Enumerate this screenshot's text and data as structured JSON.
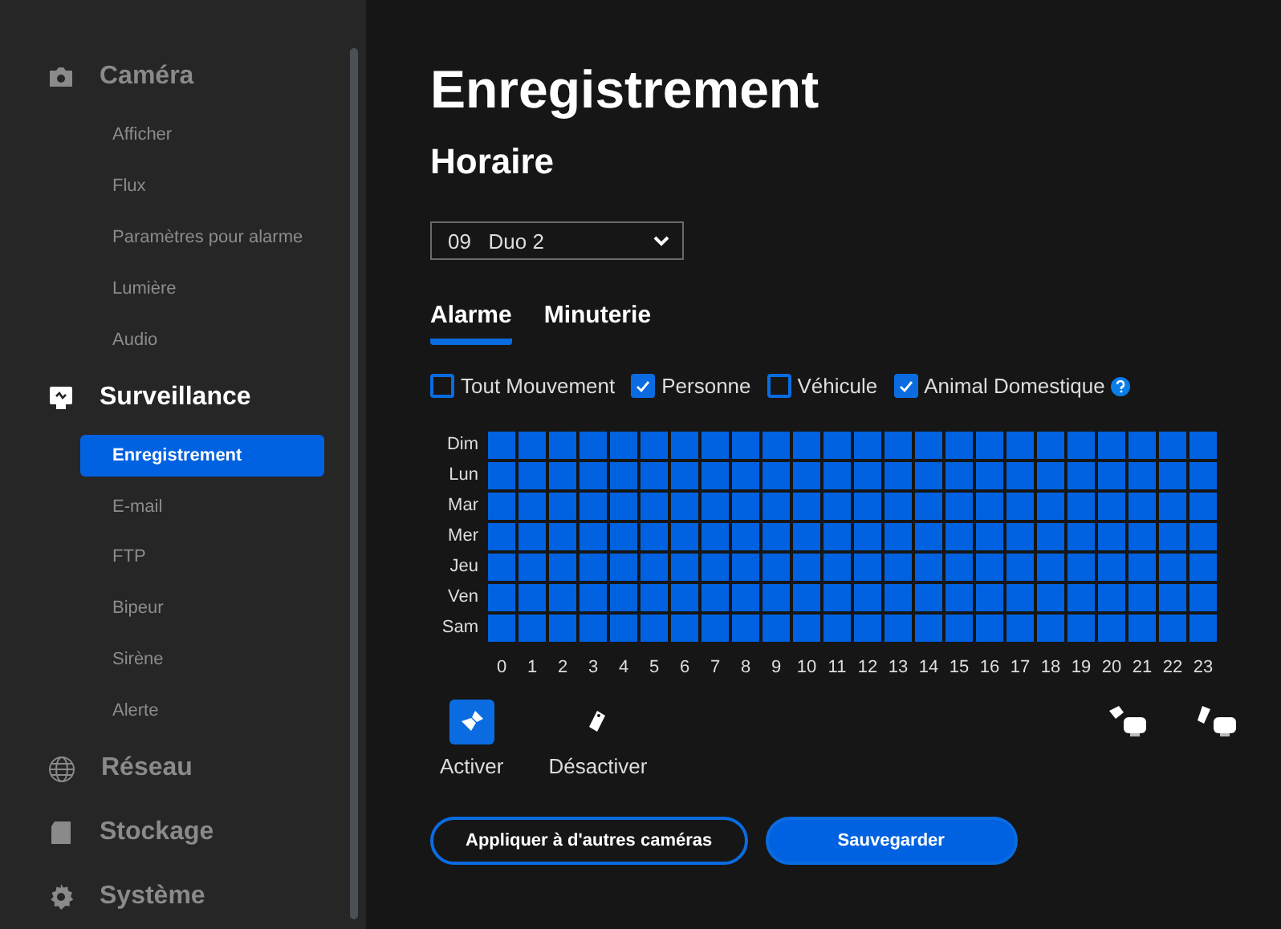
{
  "sidebar": {
    "groups": [
      {
        "kind": "camera",
        "label": "Caméra",
        "selected": false,
        "items": [
          {
            "label": "Afficher",
            "selected": false
          },
          {
            "label": "Flux",
            "selected": false
          },
          {
            "label": "Paramètres pour alarme",
            "selected": false
          },
          {
            "label": "Lumière",
            "selected": false
          },
          {
            "label": "Audio",
            "selected": false
          }
        ]
      },
      {
        "kind": "surveillance",
        "label": "Surveillance",
        "selected": true,
        "items": [
          {
            "label": "Enregistrement",
            "selected": true
          },
          {
            "label": "E-mail",
            "selected": false
          },
          {
            "label": "FTP",
            "selected": false
          },
          {
            "label": "Bipeur",
            "selected": false
          },
          {
            "label": "Sirène",
            "selected": false
          },
          {
            "label": "Alerte",
            "selected": false
          }
        ]
      },
      {
        "kind": "network",
        "label": "Réseau",
        "selected": false
      },
      {
        "kind": "storage",
        "label": "Stockage",
        "selected": false
      },
      {
        "kind": "system",
        "label": "Système",
        "selected": false
      }
    ]
  },
  "title": "Enregistrement",
  "subtitle": "Horaire",
  "camera_select": {
    "number": "09",
    "name": "Duo 2"
  },
  "tabs": [
    {
      "label": "Alarme",
      "selected": true
    },
    {
      "label": "Minuterie",
      "selected": false
    }
  ],
  "filters": [
    {
      "label": "Tout Mouvement",
      "checked": false
    },
    {
      "label": "Personne",
      "checked": true
    },
    {
      "label": "Véhicule",
      "checked": false
    },
    {
      "label": "Animal Domestique",
      "checked": true,
      "help": true
    }
  ],
  "schedule": {
    "hours": [
      "0",
      "1",
      "2",
      "3",
      "4",
      "5",
      "6",
      "7",
      "8",
      "9",
      "10",
      "11",
      "12",
      "13",
      "14",
      "15",
      "16",
      "17",
      "18",
      "19",
      "20",
      "21",
      "22",
      "23"
    ],
    "days": [
      {
        "label": "Dim",
        "slots": [
          true,
          true,
          true,
          true,
          true,
          true,
          true,
          true,
          true,
          true,
          true,
          true,
          true,
          true,
          true,
          true,
          true,
          true,
          true,
          true,
          true,
          true,
          true,
          true
        ]
      },
      {
        "label": "Lun",
        "slots": [
          true,
          true,
          true,
          true,
          true,
          true,
          true,
          true,
          true,
          true,
          true,
          true,
          true,
          true,
          true,
          true,
          true,
          true,
          true,
          true,
          true,
          true,
          true,
          true
        ]
      },
      {
        "label": "Mar",
        "slots": [
          true,
          true,
          true,
          true,
          true,
          true,
          true,
          true,
          true,
          true,
          true,
          true,
          true,
          true,
          true,
          true,
          true,
          true,
          true,
          true,
          true,
          true,
          true,
          true
        ]
      },
      {
        "label": "Mer",
        "slots": [
          true,
          true,
          true,
          true,
          true,
          true,
          true,
          true,
          true,
          true,
          true,
          true,
          true,
          true,
          true,
          true,
          true,
          true,
          true,
          true,
          true,
          true,
          true,
          true
        ]
      },
      {
        "label": "Jeu",
        "slots": [
          true,
          true,
          true,
          true,
          true,
          true,
          true,
          true,
          true,
          true,
          true,
          true,
          true,
          true,
          true,
          true,
          true,
          true,
          true,
          true,
          true,
          true,
          true,
          true
        ]
      },
      {
        "label": "Ven",
        "slots": [
          true,
          true,
          true,
          true,
          true,
          true,
          true,
          true,
          true,
          true,
          true,
          true,
          true,
          true,
          true,
          true,
          true,
          true,
          true,
          true,
          true,
          true,
          true,
          true
        ]
      },
      {
        "label": "Sam",
        "slots": [
          true,
          true,
          true,
          true,
          true,
          true,
          true,
          true,
          true,
          true,
          true,
          true,
          true,
          true,
          true,
          true,
          true,
          true,
          true,
          true,
          true,
          true,
          true,
          true
        ]
      }
    ]
  },
  "tools": [
    {
      "kind": "brush",
      "label": "Activer",
      "selected": true
    },
    {
      "kind": "eraser",
      "label": "Désactiver",
      "selected": false
    }
  ],
  "bulk_tools": [
    {
      "kind": "brush"
    },
    {
      "kind": "eraser"
    }
  ],
  "buttons": [
    {
      "kind": "outline",
      "label": "Appliquer à d'autres caméras"
    },
    {
      "kind": "primary",
      "label": "Sauvegarder"
    }
  ]
}
